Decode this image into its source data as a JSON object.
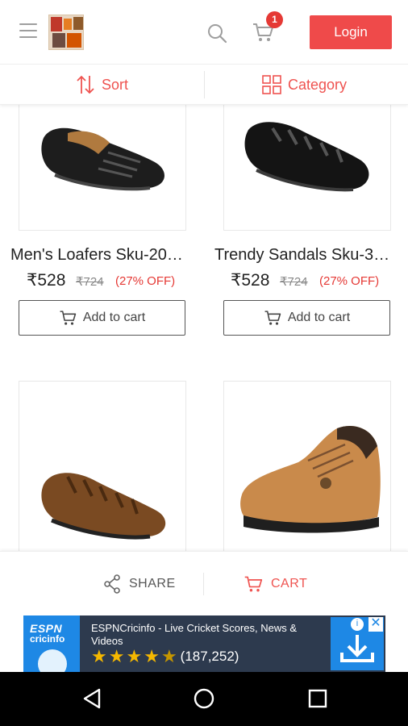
{
  "header": {
    "cart_count": "1",
    "login_label": "Login"
  },
  "filters": {
    "sort_label": "Sort",
    "category_label": "Category"
  },
  "products": [
    {
      "name": "Men's Loafers Sku-20…",
      "price": "₹528",
      "mrp": "₹724",
      "discount": "(27% OFF)",
      "button": "Add to cart"
    },
    {
      "name": "Trendy Sandals Sku-3…",
      "price": "₹528",
      "mrp": "₹724",
      "discount": "(27% OFF)",
      "button": "Add to cart"
    }
  ],
  "actions": {
    "share_label": "SHARE",
    "cart_label": "CART"
  },
  "ad": {
    "logo_line1": "ESPN",
    "logo_line2": "cricinfo",
    "title": "ESPNCricinfo - Live Cricket Scores, News & Videos",
    "rating": 4.5,
    "rating_count": "(187,252)"
  },
  "colors": {
    "accent": "#ef4a4a",
    "badge": "#e53935",
    "ad_background": "#2d3a4e",
    "ad_blue": "#1e88e5"
  }
}
